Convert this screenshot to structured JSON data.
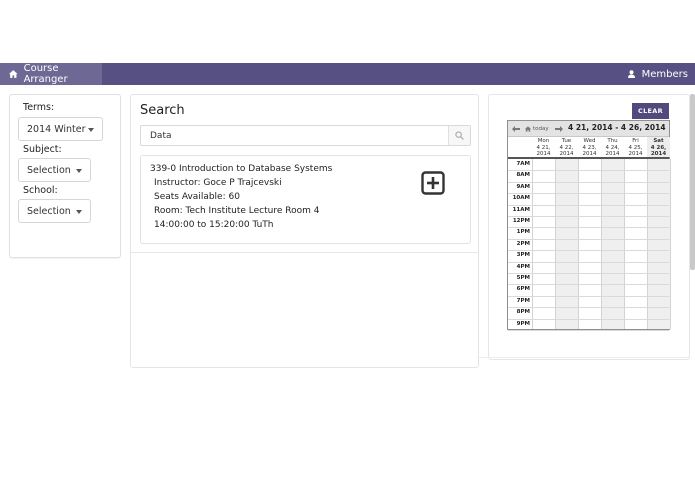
{
  "app": {
    "brand": "Course Arranger",
    "members": "Members"
  },
  "filters": {
    "terms_label": "Terms:",
    "terms_value": "2014 Winter",
    "subject_label": "Subject:",
    "subject_value": "Selection",
    "school_label": "School:",
    "school_value": "Selection"
  },
  "search": {
    "title": "Search",
    "query": "Data",
    "results": [
      {
        "course": "339-0 Introduction to Database Systems",
        "instructor": "Instructor: Goce P Trajcevski",
        "seats": "Seats Available: 60",
        "room": "Room: Tech Institute Lecture Room 4",
        "time": "14:00:00 to 15:20:00 TuTh"
      }
    ]
  },
  "calendar": {
    "clear_label": "CLEAR",
    "today_label": "today",
    "title": "4 21, 2014 - 4 26, 2014",
    "days": [
      {
        "name": "Mon",
        "date": "4 21,",
        "year": "2014"
      },
      {
        "name": "Tue",
        "date": "4 22,",
        "year": "2014"
      },
      {
        "name": "Wed",
        "date": "4 23,",
        "year": "2014"
      },
      {
        "name": "Thu",
        "date": "4 24,",
        "year": "2014"
      },
      {
        "name": "Fri",
        "date": "4 25,",
        "year": "2014"
      },
      {
        "name": "Sat",
        "date": "4 26,",
        "year": "2014"
      }
    ],
    "today_index": 5,
    "hours": [
      "7AM",
      "8AM",
      "9AM",
      "10AM",
      "11AM",
      "12PM",
      "1PM",
      "2PM",
      "3PM",
      "4PM",
      "5PM",
      "6PM",
      "7PM",
      "8PM",
      "9PM"
    ]
  },
  "colors": {
    "navbar": "#575082",
    "brand_bg": "#6e6895",
    "clear_button": "#514a7c"
  },
  "icons": {
    "home": "home-icon",
    "user": "user-icon",
    "search": "search-icon",
    "add": "plus-square-icon",
    "prev": "arrow-left-icon",
    "next": "arrow-right-icon"
  }
}
